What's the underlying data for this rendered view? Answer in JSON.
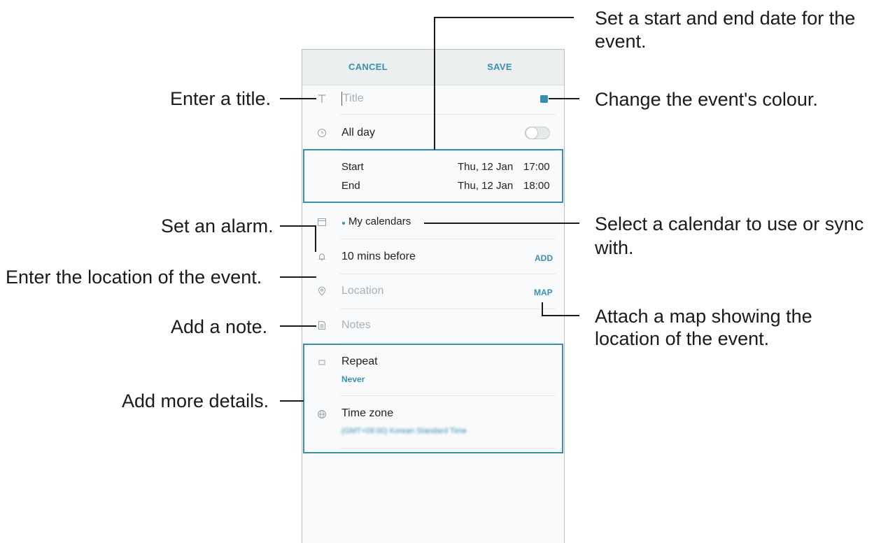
{
  "header": {
    "cancel_label": "CANCEL",
    "save_label": "SAVE"
  },
  "form": {
    "title_placeholder": "Title",
    "all_day_label": "All day",
    "start_label": "Start",
    "start_date": "Thu, 12 Jan",
    "start_time": "17:00",
    "end_label": "End",
    "end_date": "Thu, 12 Jan",
    "end_time": "18:00",
    "calendar_label": "My calendars",
    "alarm_label": "10 mins before",
    "add_label": "ADD",
    "location_placeholder": "Location",
    "map_label": "MAP",
    "notes_placeholder": "Notes",
    "repeat_label": "Repeat",
    "repeat_value": "Never",
    "timezone_label": "Time zone",
    "timezone_value": "(GMT+09:00) Korean Standard Time"
  },
  "callouts": {
    "title": "Enter a title.",
    "date_line1": "Set a start and end date for the",
    "date_line2": "event.",
    "colour": "Change the event's colour.",
    "alarm": "Set an alarm.",
    "calendar_line1": "Select a calendar to use or sync",
    "calendar_line2": "with.",
    "location": "Enter the location of the event.",
    "note": "Add a note.",
    "map_line1": "Attach a map showing the",
    "map_line2": "location of the event.",
    "details": "Add more details."
  },
  "colors": {
    "accent": "#3a8fb0",
    "event_colour": "#3a8fb0"
  },
  "icons": [
    "title-icon",
    "clock-icon",
    "calendar-icon",
    "bell-icon",
    "location-pin-icon",
    "notes-icon",
    "repeat-icon",
    "globe-icon"
  ]
}
